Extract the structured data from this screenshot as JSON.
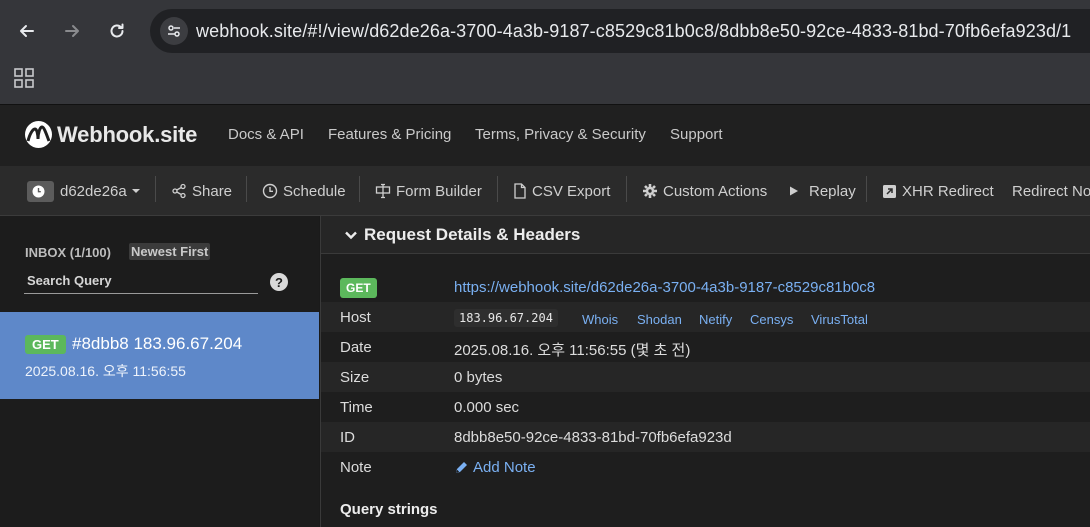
{
  "browser": {
    "url": "webhook.site/#!/view/d62de26a-3700-4a3b-9187-c8529c81b0c8/8dbb8e50-92ce-4833-81bd-70fb6efa923d/1",
    "back_icon": "back-arrow-icon",
    "forward_icon": "forward-arrow-icon",
    "reload_icon": "reload-icon",
    "site_info_icon": "tune-icon",
    "apps_icon": "apps-grid-icon"
  },
  "header": {
    "logo_text": "Webhook.site",
    "nav": [
      "Docs & API",
      "Features & Pricing",
      "Terms, Privacy & Security",
      "Support"
    ]
  },
  "toolbar": {
    "token": "d62de26a",
    "items": [
      "Share",
      "Schedule",
      "Form Builder",
      "CSV Export",
      "Custom Actions",
      "Replay",
      "XHR Redirect",
      "Redirect No"
    ]
  },
  "sidebar": {
    "inbox_label": "INBOX (1/100)",
    "sort_label": "Newest First",
    "search_placeholder": "Search Query",
    "help": "?",
    "request": {
      "method": "GET",
      "title": "#8dbb8 183.96.67.204",
      "date": "2025.08.16. 오후 11:56:55"
    }
  },
  "details": {
    "heading": "Request Details & Headers",
    "method": "GET",
    "url": "https://webhook.site/d62de26a-3700-4a3b-9187-c8529c81b0c8",
    "labels": {
      "host": "Host",
      "date": "Date",
      "size": "Size",
      "time": "Time",
      "id": "ID",
      "note": "Note"
    },
    "host_ip": "183.96.67.204",
    "lookups": [
      "Whois",
      "Shodan",
      "Netify",
      "Censys",
      "VirusTotal"
    ],
    "date_value": "2025.08.16. 오후 11:56:55 (몇 초 전)",
    "size_value": "0 bytes",
    "time_value": "0.000 sec",
    "id_value": "8dbb8e50-92ce-4833-81bd-70fb6efa923d",
    "add_note": "Add Note",
    "query_strings": "Query strings"
  },
  "colors": {
    "accent_blue": "#5e88c9",
    "get_green": "#5cb85c",
    "link_blue": "#7ab0f2"
  }
}
